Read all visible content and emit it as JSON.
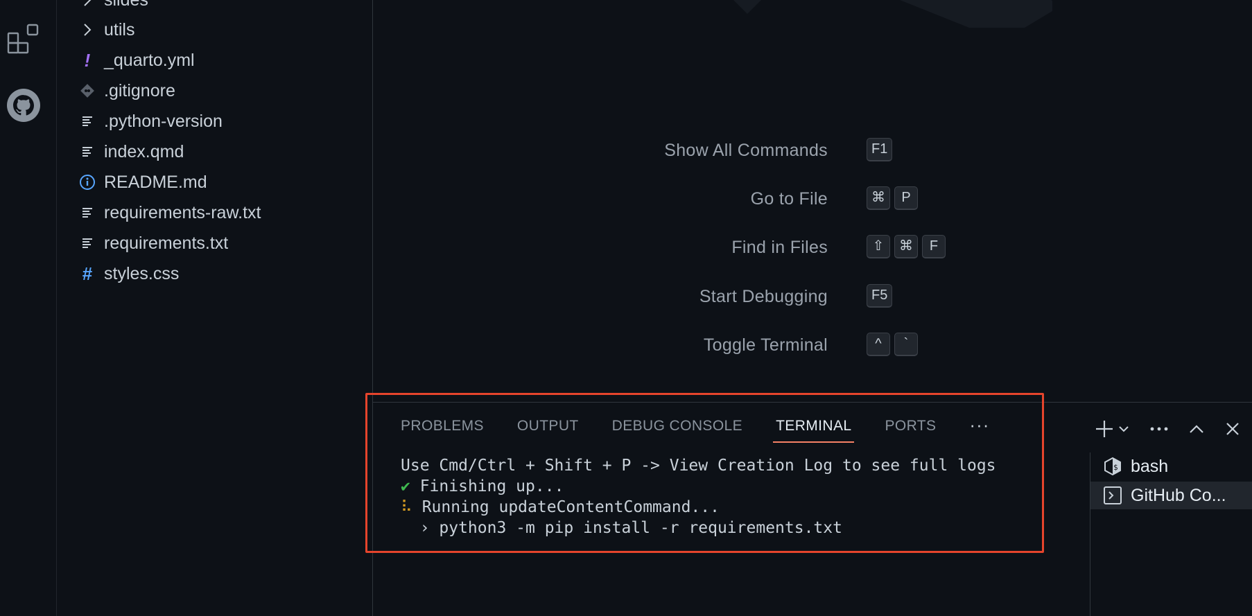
{
  "explorer": {
    "items": [
      {
        "label": "slides",
        "icon": "chevron-right-icon"
      },
      {
        "label": "utils",
        "icon": "chevron-right-icon"
      },
      {
        "label": "_quarto.yml",
        "icon": "exclamation-icon"
      },
      {
        "label": ".gitignore",
        "icon": "git-icon"
      },
      {
        "label": ".python-version",
        "icon": "file-lines-icon"
      },
      {
        "label": "index.qmd",
        "icon": "file-lines-icon"
      },
      {
        "label": "README.md",
        "icon": "info-icon"
      },
      {
        "label": "requirements-raw.txt",
        "icon": "file-lines-icon"
      },
      {
        "label": "requirements.txt",
        "icon": "file-lines-icon"
      },
      {
        "label": "styles.css",
        "icon": "hash-icon"
      }
    ]
  },
  "welcome": {
    "shortcuts": [
      {
        "label": "Show All Commands",
        "keys": [
          "F1"
        ]
      },
      {
        "label": "Go to File",
        "keys": [
          "⌘",
          "P"
        ]
      },
      {
        "label": "Find in Files",
        "keys": [
          "⇧",
          "⌘",
          "F"
        ]
      },
      {
        "label": "Start Debugging",
        "keys": [
          "F5"
        ]
      },
      {
        "label": "Toggle Terminal",
        "keys": [
          "^",
          "`"
        ]
      }
    ]
  },
  "panel": {
    "tabs": [
      "PROBLEMS",
      "OUTPUT",
      "DEBUG CONSOLE",
      "TERMINAL",
      "PORTS"
    ],
    "active_tab": "TERMINAL",
    "more": "···",
    "terminal_lines": [
      {
        "prefix": "",
        "text": "Use Cmd/Ctrl + Shift + P -> View Creation Log to see full logs"
      },
      {
        "prefix": "✔",
        "text": " Finishing up..."
      },
      {
        "prefix": "⠧",
        "text": " Running updateContentCommand..."
      },
      {
        "prefix": "",
        "text": "  › python3 -m pip install -r requirements.txt"
      }
    ],
    "terminals": [
      {
        "label": "bash",
        "icon": "bash-icon"
      },
      {
        "label": "GitHub Co...",
        "icon": "terminal-icon",
        "selected": true
      }
    ]
  },
  "colors": {
    "background": "#0d1117",
    "tab_active_underline": "#f78166",
    "highlight_box": "#e5442c",
    "check": "#3fb950",
    "spinner": "#d29922",
    "yaml_icon": "#a371f7",
    "css_icon": "#58a6ff"
  }
}
